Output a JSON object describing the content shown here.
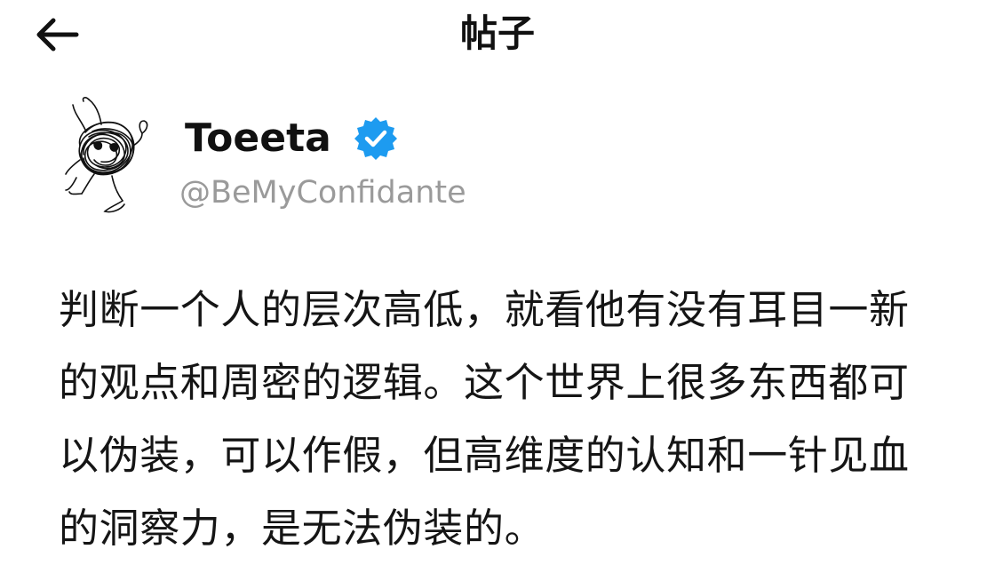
{
  "header": {
    "title": "帖子",
    "back_icon": "arrow-left-icon"
  },
  "author": {
    "display_name": "Toeeta",
    "handle": "@BeMyConfidante",
    "verified_icon": "verified-badge-icon",
    "verified_color": "#1D9BF0",
    "avatar_icon": "scribble-avatar-icon"
  },
  "post": {
    "text": "判断一个人的层次高低，就看他有没有耳目一新\n的观点和周密的逻辑。这个世界上很多东西都可\n以伪装，可以作假，但高维度的认知和一针见血\n的洞察力，是无法伪装的。"
  },
  "colors": {
    "background": "#FFFFFF",
    "text": "#111111",
    "secondary_text": "#9A9A9A",
    "accent": "#1D9BF0"
  }
}
